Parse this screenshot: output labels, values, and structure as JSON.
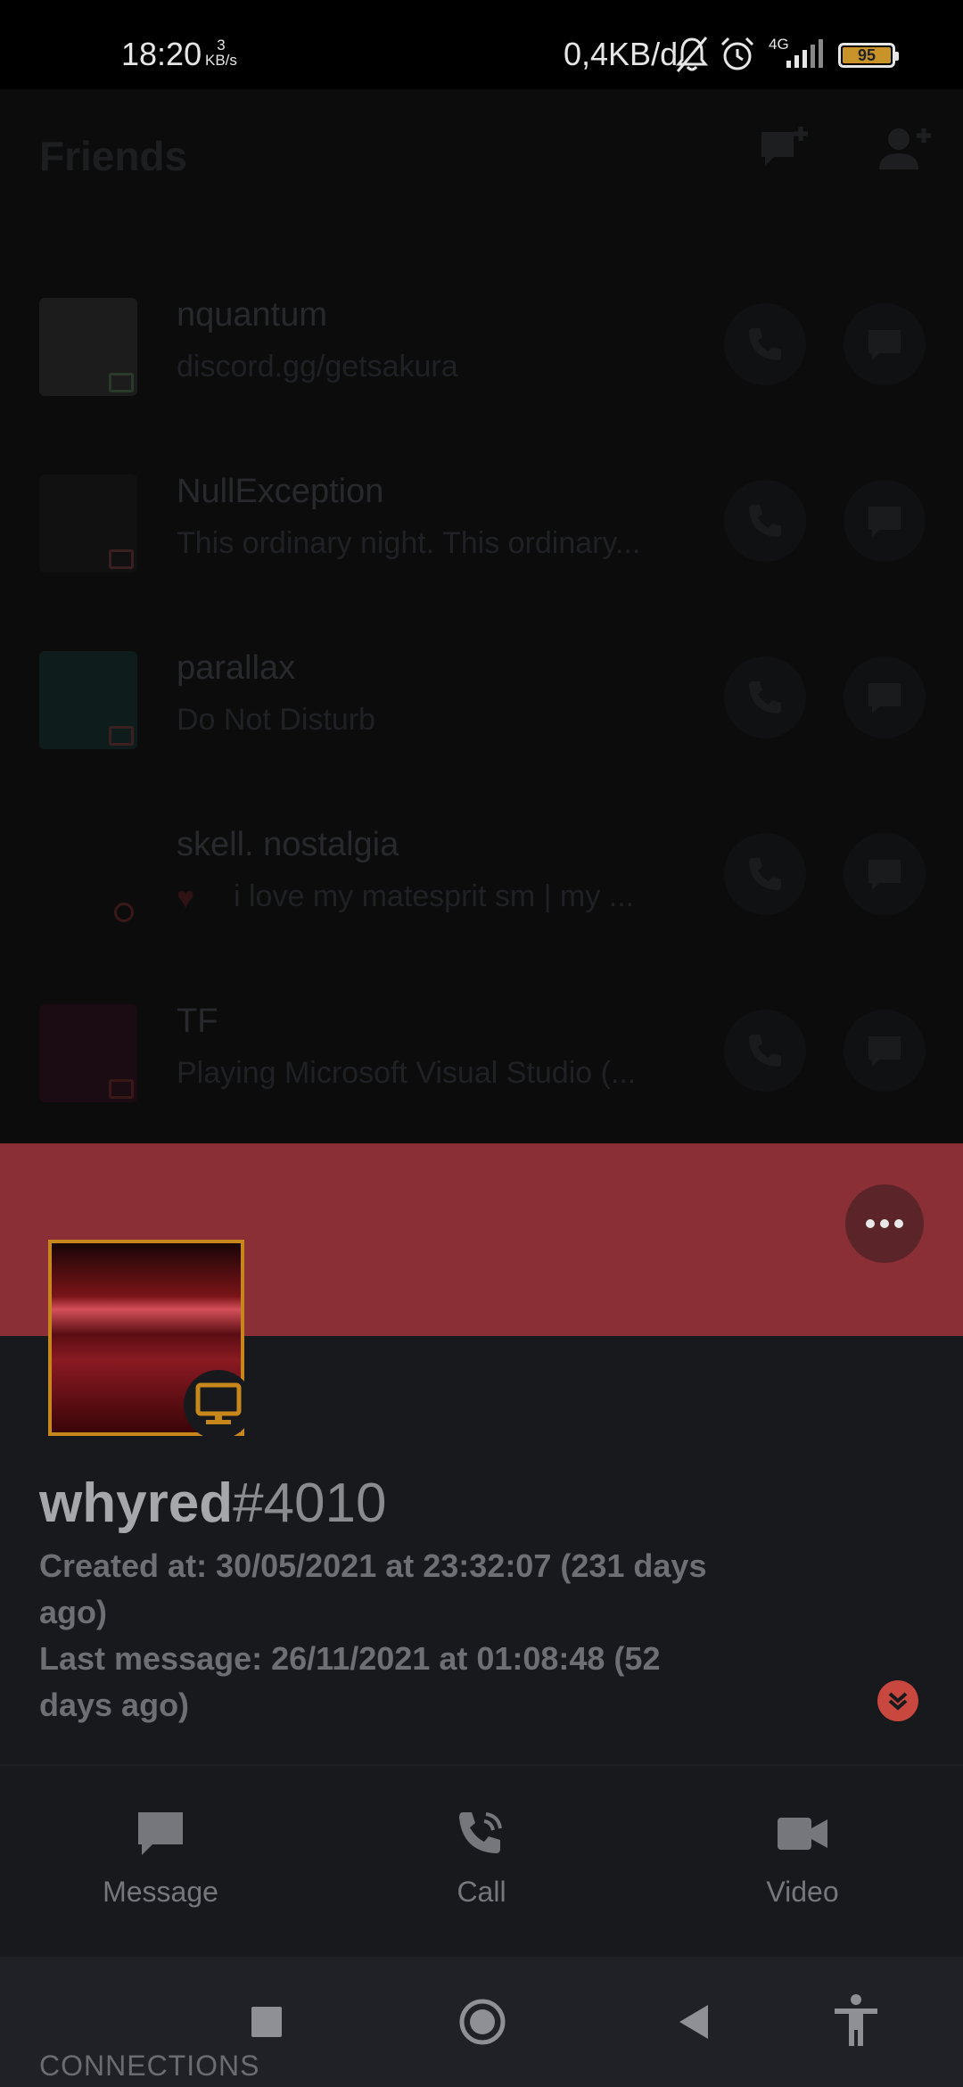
{
  "status_bar": {
    "time": "18:20",
    "net_rate_value": "3",
    "net_rate_unit": "KB/s",
    "data_usage": "0,4KB/d",
    "network_type": "4G",
    "battery": "95"
  },
  "friends": {
    "title": "Friends",
    "items": [
      {
        "name": "nquantum",
        "subtitle": "discord.gg/getsakura"
      },
      {
        "name": "NullException",
        "subtitle": "This ordinary night. This ordinary..."
      },
      {
        "name": "parallax",
        "subtitle": "Do Not Disturb"
      },
      {
        "name": "skell. nostalgia",
        "subtitle": "i love my matesprit sm | my ..."
      },
      {
        "name": "TF",
        "subtitle": "Playing Microsoft Visual Studio (..."
      }
    ]
  },
  "profile": {
    "username": "whyred",
    "discriminator": "#4010",
    "created_line1": "Created at: 30/05/2021 at 23:32:07 (231 days",
    "created_line2": "ago)",
    "last_message_line1": "Last message: 26/11/2021 at 01:08:48 (52",
    "last_message_line2": "days ago)",
    "actions": {
      "message": "Message",
      "call": "Call",
      "video": "Video"
    },
    "connections_header": "CONNECTIONS"
  },
  "colors": {
    "banner": "#8b2f36",
    "avatar_border": "#c8871a",
    "expand": "#c8473e"
  }
}
